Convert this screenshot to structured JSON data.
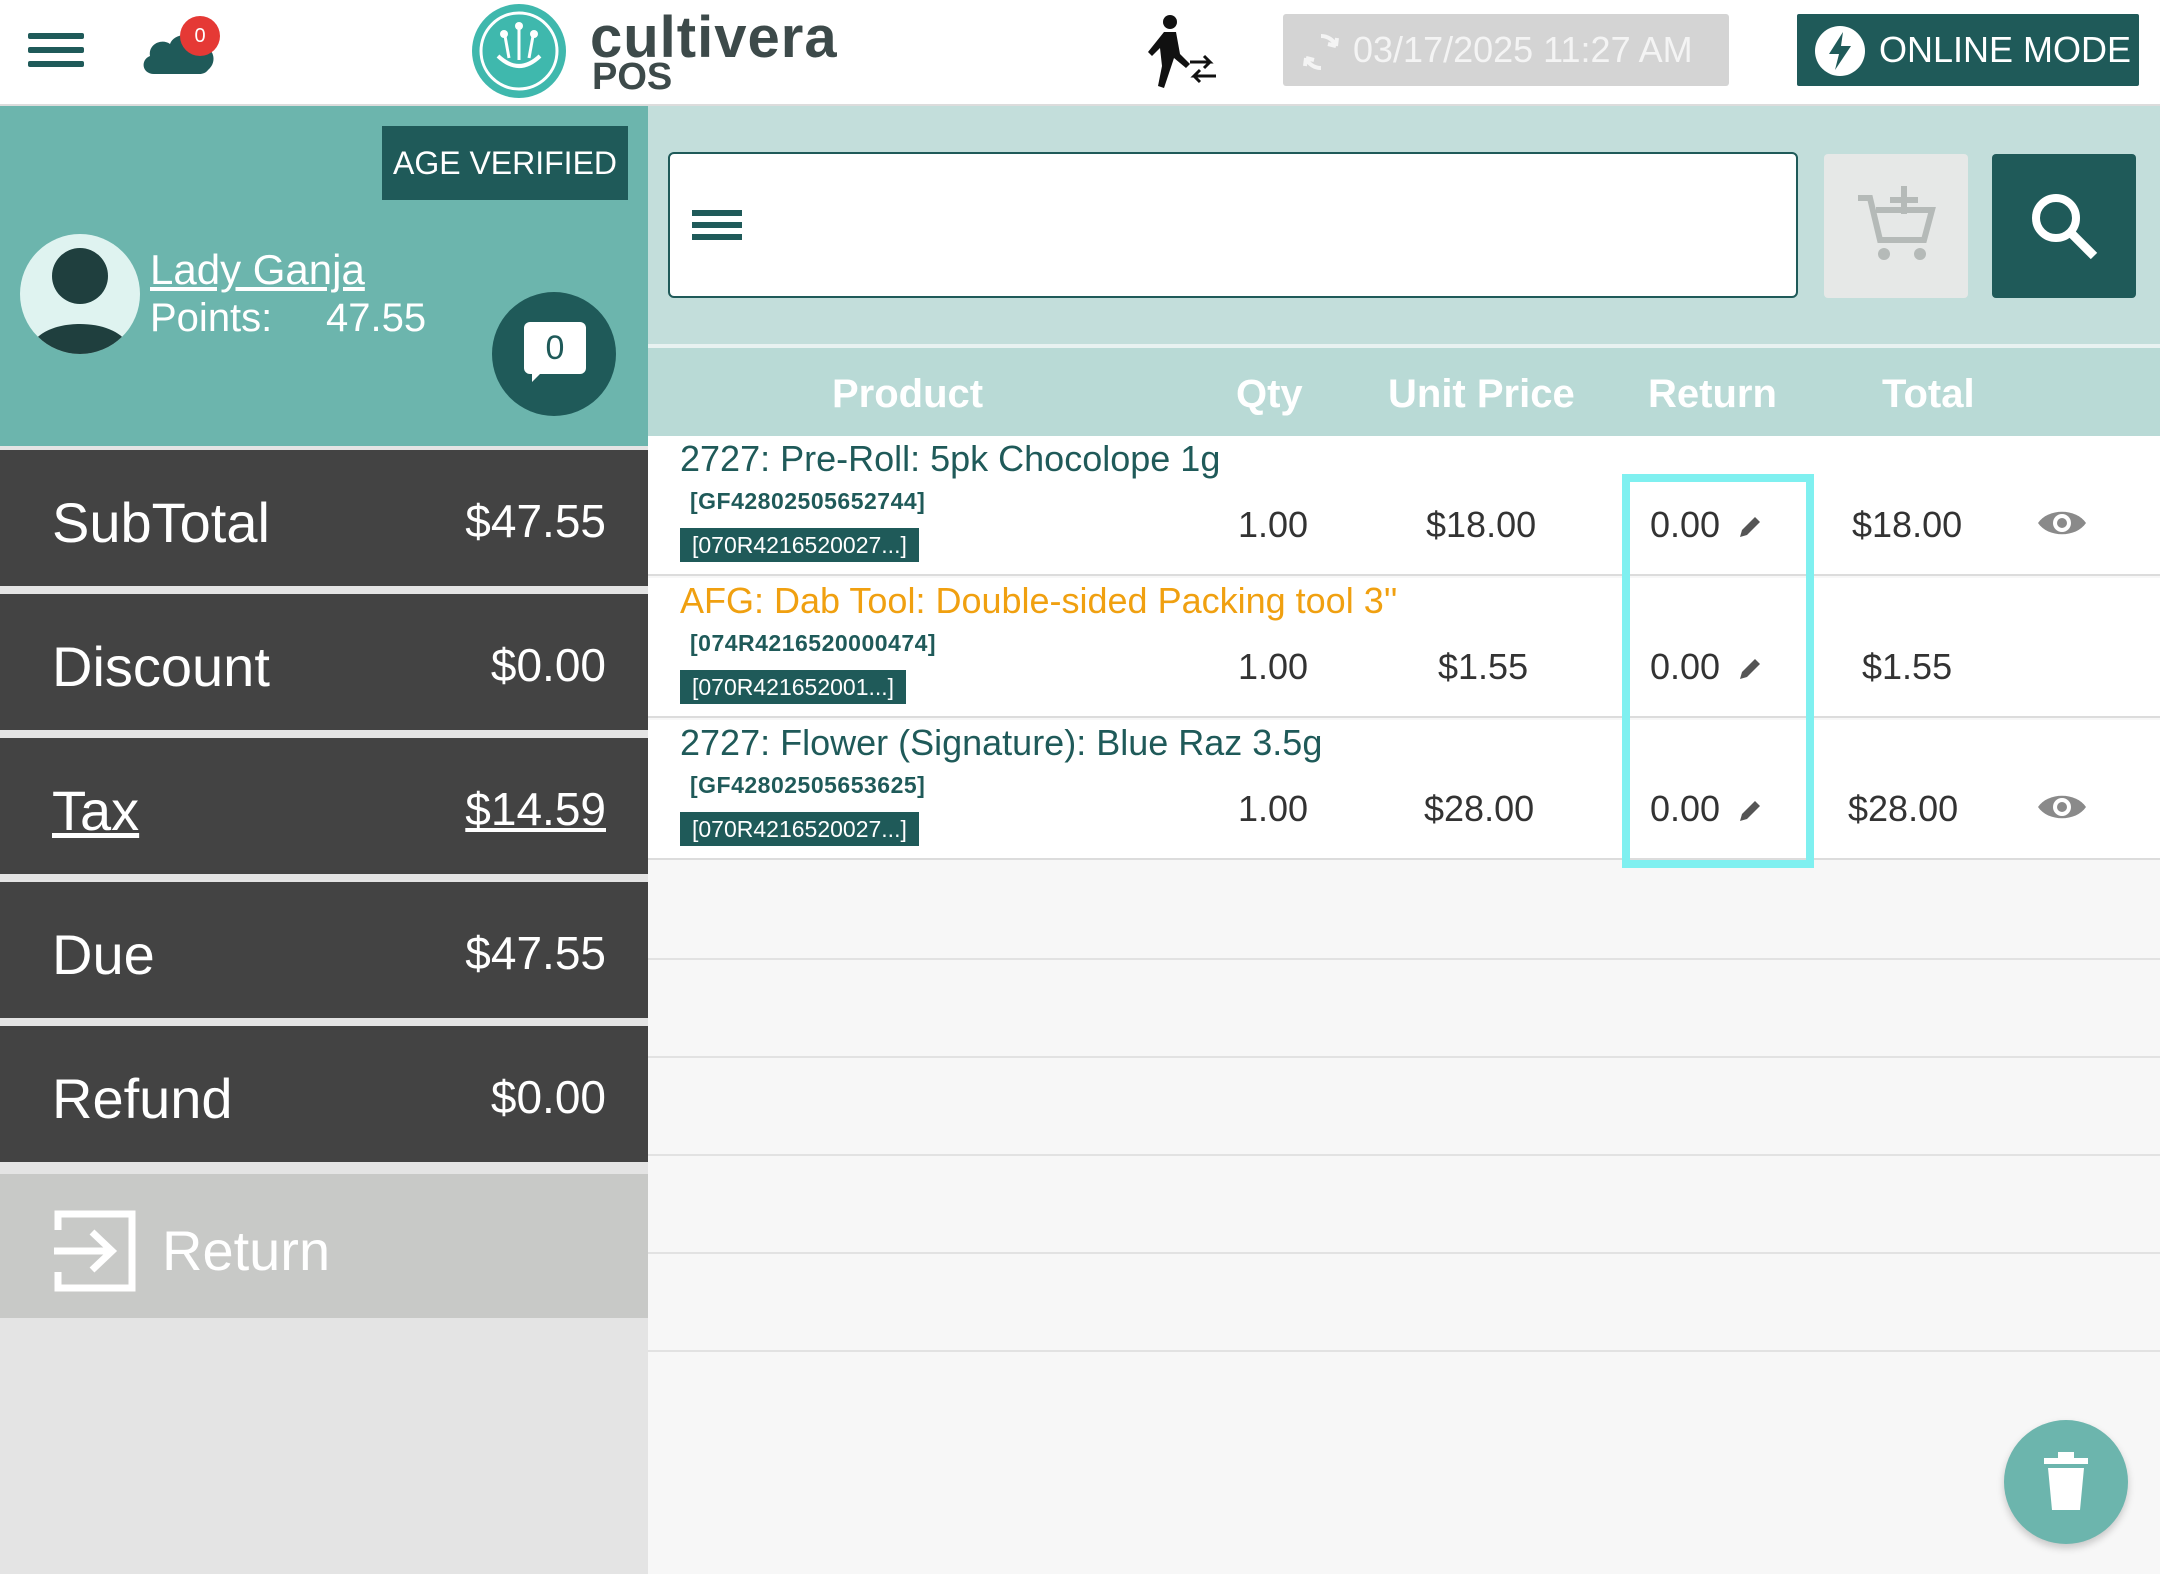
{
  "topbar": {
    "notification_count": "0",
    "logo_name": "cultivera",
    "logo_sub": "POS",
    "datetime": "03/17/2025 11:27 AM",
    "mode_label": "ONLINE MODE"
  },
  "customer": {
    "age_badge": "AGE VERIFIED",
    "name": "Lady Ganja",
    "points_label": "Points:",
    "points_value": "47.55",
    "message_count": "0"
  },
  "summary": {
    "subtotal": {
      "label": "SubTotal",
      "value": "$47.55"
    },
    "discount": {
      "label": "Discount",
      "value": "$0.00"
    },
    "tax": {
      "label": "Tax",
      "value": "$14.59"
    },
    "due": {
      "label": "Due",
      "value": "$47.55"
    },
    "refund": {
      "label": "Refund",
      "value": "$0.00"
    }
  },
  "return_button": {
    "label": "Return"
  },
  "table": {
    "headers": {
      "product": "Product",
      "qty": "Qty",
      "unit_price": "Unit Price",
      "return": "Return",
      "total": "Total"
    },
    "rows": [
      {
        "name": "2727: Pre-Roll: 5pk Chocolope 1g",
        "sku": "[GF42802505652744]",
        "tag": "[070R4216520027...]",
        "qty": "1.00",
        "unit_price": "$18.00",
        "return": "0.00",
        "total": "$18.00",
        "has_eye": true
      },
      {
        "name": "AFG: Dab Tool: Double-sided Packing tool 3''",
        "sku": "[074R4216520000474]",
        "tag": "[070R421652001...]",
        "qty": "1.00",
        "unit_price": "$1.55",
        "return": "0.00",
        "total": "$1.55",
        "has_eye": false
      },
      {
        "name": "2727: Flower (Signature): Blue Raz 3.5g",
        "sku": "[GF42802505653625]",
        "tag": "[070R4216520027...]",
        "qty": "1.00",
        "unit_price": "$28.00",
        "return": "0.00",
        "total": "$28.00",
        "has_eye": true
      }
    ]
  },
  "colors": {
    "brand_dark": "#1f5a59",
    "brand_teal": "#6cb5ad",
    "summary_bg": "#434343",
    "accent_orange": "#f0a010",
    "highlight": "#7ff0f0"
  },
  "icons": [
    "menu-icon",
    "cloud-icon",
    "walk-transfer-icon",
    "sync-icon",
    "bolt-icon",
    "user-avatar-icon",
    "chat-icon",
    "return-icon",
    "cart-add-icon",
    "search-icon",
    "pencil-icon",
    "eye-icon",
    "trash-icon"
  ]
}
